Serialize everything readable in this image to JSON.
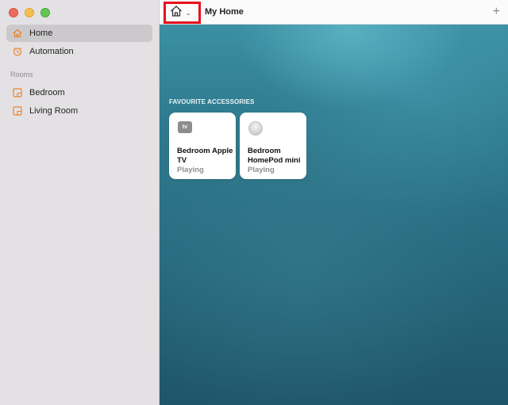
{
  "window": {
    "controls": [
      "close",
      "minimize",
      "zoom"
    ]
  },
  "sidebar": {
    "items": [
      {
        "label": "Home",
        "icon": "house-icon",
        "selected": true
      },
      {
        "label": "Automation",
        "icon": "clock-icon",
        "selected": false
      }
    ],
    "rooms_label": "Rooms",
    "rooms": [
      {
        "label": "Bedroom",
        "icon": "room-icon"
      },
      {
        "label": "Living Room",
        "icon": "room-icon"
      }
    ]
  },
  "toolbar": {
    "home_menu_icon": "house-icon",
    "title": "My Home",
    "add_label": "+"
  },
  "main": {
    "favourites_heading": "FAVOURITE ACCESSORIES",
    "tiles": [
      {
        "name": "Bedroom Apple TV",
        "status": "Playing",
        "icon": "apple-tv-icon",
        "icon_text": "tv"
      },
      {
        "name": "Bedroom HomePod mini",
        "status": "Playing",
        "icon": "homepod-mini-icon"
      }
    ]
  },
  "colors": {
    "accent_orange": "#e8852b",
    "highlight_red": "#e8101c"
  }
}
